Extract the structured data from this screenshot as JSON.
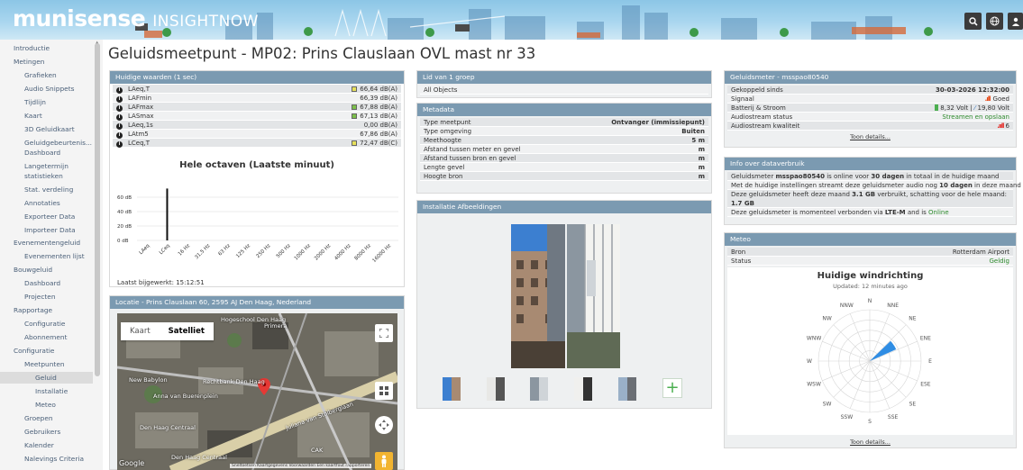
{
  "brand": {
    "name": "munisense",
    "product": "INSIGHTNOW"
  },
  "toolbar": {
    "icons": [
      "search-icon",
      "globe-icon",
      "user-icon"
    ]
  },
  "sidebar": [
    {
      "label": "Introductie",
      "level": 0
    },
    {
      "label": "Metingen",
      "level": 0
    },
    {
      "label": "Grafieken",
      "level": 1
    },
    {
      "label": "Audio Snippets",
      "level": 1
    },
    {
      "label": "Tijdlijn",
      "level": 1
    },
    {
      "label": "Kaart",
      "level": 1
    },
    {
      "label": "3D Geluidkaart",
      "level": 1
    },
    {
      "label": "Geluidgebeurtenis...",
      "level": 1
    },
    {
      "label": "Dashboard",
      "level": 1
    },
    {
      "label": "Langetermijn",
      "level": 1
    },
    {
      "label": "statistieken",
      "level": 1
    },
    {
      "label": "Stat. verdeling",
      "level": 1
    },
    {
      "label": "Annotaties",
      "level": 1
    },
    {
      "label": "Exporteer Data",
      "level": 1
    },
    {
      "label": "Importeer Data",
      "level": 1
    },
    {
      "label": "Evenementengeluid",
      "level": 0
    },
    {
      "label": "Evenementen lijst",
      "level": 1
    },
    {
      "label": "Bouwgeluid",
      "level": 0
    },
    {
      "label": "Dashboard",
      "level": 1
    },
    {
      "label": "Projecten",
      "level": 1
    },
    {
      "label": "Rapportage",
      "level": 0
    },
    {
      "label": "Configuratie",
      "level": 1
    },
    {
      "label": "Abonnement",
      "level": 1
    },
    {
      "label": "Configuratie",
      "level": 0
    },
    {
      "label": "Meetpunten",
      "level": 1
    },
    {
      "label": "Geluid",
      "level": 2,
      "active": true
    },
    {
      "label": "Installatie",
      "level": 2
    },
    {
      "label": "Meteo",
      "level": 2
    },
    {
      "label": "Groepen",
      "level": 1
    },
    {
      "label": "Gebruikers",
      "level": 1
    },
    {
      "label": "Kalender",
      "level": 1
    },
    {
      "label": "Nalevings Criteria",
      "level": 1
    }
  ],
  "page_title": "Geluidsmeetpunt - MP02: Prins Clauslaan OVL mast nr 33",
  "current": {
    "header": "Huidige waarden (1 sec)",
    "rows": [
      {
        "label": "LAeq,T",
        "value": "66,64 dB(A)",
        "square": "#e6e05a"
      },
      {
        "label": "LAFmin",
        "value": "66,39 dB(A)",
        "square": ""
      },
      {
        "label": "LAFmax",
        "value": "67,88 dB(A)",
        "square": "#7cc04b"
      },
      {
        "label": "LASmax",
        "value": "67,13 dB(A)",
        "square": "#7cc04b"
      },
      {
        "label": "LAeq,1s",
        "value": "0,00 dB(A)",
        "square": ""
      },
      {
        "label": "LAtm5",
        "value": "67,86 dB(A)",
        "square": ""
      },
      {
        "label": "LCeq,T",
        "value": "72,47 dB(C)",
        "square": "#e6e05a"
      }
    ],
    "updated": "Laatst bijgewerkt: 15:12:51"
  },
  "chart_data": {
    "type": "bar",
    "title": "Hele octaven (Laatste minuut)",
    "categories": [
      "LAeq",
      "LCeq",
      "16 Hz",
      "31,5 Hz",
      "63 Hz",
      "125 Hz",
      "250 Hz",
      "500 Hz",
      "1000 Hz",
      "2000 Hz",
      "4000 Hz",
      "8000 Hz",
      "16000 Hz"
    ],
    "values": [
      0,
      72,
      0,
      0,
      0,
      0,
      0,
      0,
      0,
      0,
      0,
      0,
      0
    ],
    "yticks": [
      "0 dB",
      "20 dB",
      "40 dB",
      "60 dB"
    ],
    "ylim": [
      0,
      80
    ],
    "grid": true
  },
  "location": {
    "header": "Locatie - Prins Clauslaan 60, 2595 AJ Den Haag, Nederland",
    "map_tab": "Kaart",
    "sat_tab": "Satelliet",
    "labels": [
      "Hogeschool Den Haag",
      "Primera",
      "New Babylon",
      "Rechtbank Den Haag",
      "Anna van Buerenplein",
      "Juliana van Stolberglaan",
      "Den Haag Centraal",
      "Den Haag Centraal",
      "CAK",
      "Google"
    ],
    "footer": "Sneltoetsen  Kaartgegevens  Voorwaarden  Een kaartfout rapporteren"
  },
  "group": {
    "header": "Lid van 1 groep",
    "item": "All Objects"
  },
  "metadata": {
    "header": "Metadata",
    "rows": [
      {
        "label": "Type meetpunt",
        "value": "Ontvanger (immissiepunt)"
      },
      {
        "label": "Type omgeving",
        "value": "Buiten"
      },
      {
        "label": "Meethoogte",
        "value": "5 m"
      },
      {
        "label": "Afstand tussen meter en gevel",
        "value": "m"
      },
      {
        "label": "Afstand tussen bron en gevel",
        "value": "m"
      },
      {
        "label": "Lengte gevel",
        "value": "m"
      },
      {
        "label": "Hoogte bron",
        "value": "m"
      }
    ]
  },
  "images": {
    "header": "Installatie Afbeeldingen",
    "add": "+"
  },
  "meter": {
    "header": "Geluidsmeter - msspao80540",
    "rows": [
      {
        "label": "Gekoppeld sinds",
        "value": "30-03-2026 12:32:00"
      },
      {
        "label": "Signaal",
        "value": "Goed"
      },
      {
        "label": "Batterij & Stroom",
        "value": "8,32 Volt | ",
        "value2": "19,80 Volt"
      },
      {
        "label": "Audiostream status",
        "value": "Streamen en opslaan"
      },
      {
        "label": "Audiostream kwaliteit",
        "value": "6"
      }
    ],
    "link": "Toon details..."
  },
  "usage": {
    "header": "Info over dataverbruik",
    "l1a": "Geluidsmeter ",
    "l1b": "msspao80540",
    "l1c": " is online voor ",
    "l1d": "30 dagen",
    "l1e": " in totaal in de huidige maand",
    "l2a": "Met de huidige instellingen streamt deze geluidsmeter audio nog ",
    "l2b": "10 dagen",
    "l2c": " in deze maand",
    "l3a": "Deze geluidsmeter heeft deze maand ",
    "l3b": "3.1 GB",
    "l3c": " verbruikt, schatting voor de hele maand: ",
    "l3d": "1.7 GB",
    "l4a": "Deze geluidsmeter is momenteel verbonden via ",
    "l4b": "LTE-M",
    "l4c": " and is ",
    "l4d": "Online"
  },
  "meteo": {
    "header": "Meteo",
    "rows": [
      {
        "label": "Bron",
        "value": "Rotterdam Airport"
      },
      {
        "label": "Status",
        "value": "Geldig"
      }
    ],
    "wind_title": "Huidige windrichting",
    "wind_sub": "Updated: 12 minutes ago",
    "directions": [
      "N",
      "NNE",
      "NE",
      "ENE",
      "E",
      "ESE",
      "SE",
      "SSE",
      "S",
      "SSW",
      "SW",
      "WSW",
      "W",
      "WNW",
      "NW",
      "NNW"
    ],
    "wind_direction_deg": 56,
    "link": "Toon details..."
  }
}
